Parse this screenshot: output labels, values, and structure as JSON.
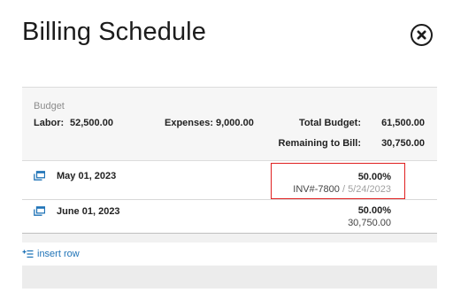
{
  "header": {
    "title": "Billing Schedule"
  },
  "budget": {
    "caption": "Budget",
    "labor_label": "Labor:",
    "labor_value": "52,500.00",
    "expenses_label": "Expenses:",
    "expenses_value": "9,000.00",
    "total_label": "Total Budget:",
    "total_value": "61,500.00",
    "remaining_label": "Remaining to Bill:",
    "remaining_value": "30,750.00"
  },
  "rows": [
    {
      "date": "May 01, 2023",
      "percent": "50.00%",
      "invoice": "INV#-7800",
      "separator": "/",
      "invoice_date": "5/24/2023"
    },
    {
      "date": "June 01, 2023",
      "percent": "50.00%",
      "amount": "30,750.00"
    }
  ],
  "actions": {
    "insert_row": "insert row"
  },
  "icons": {
    "close": "close-icon",
    "row": "copy-window-icon",
    "insert": "insert-row-icon"
  },
  "colors": {
    "accent": "#1f73b7",
    "highlight": "#e02020"
  }
}
